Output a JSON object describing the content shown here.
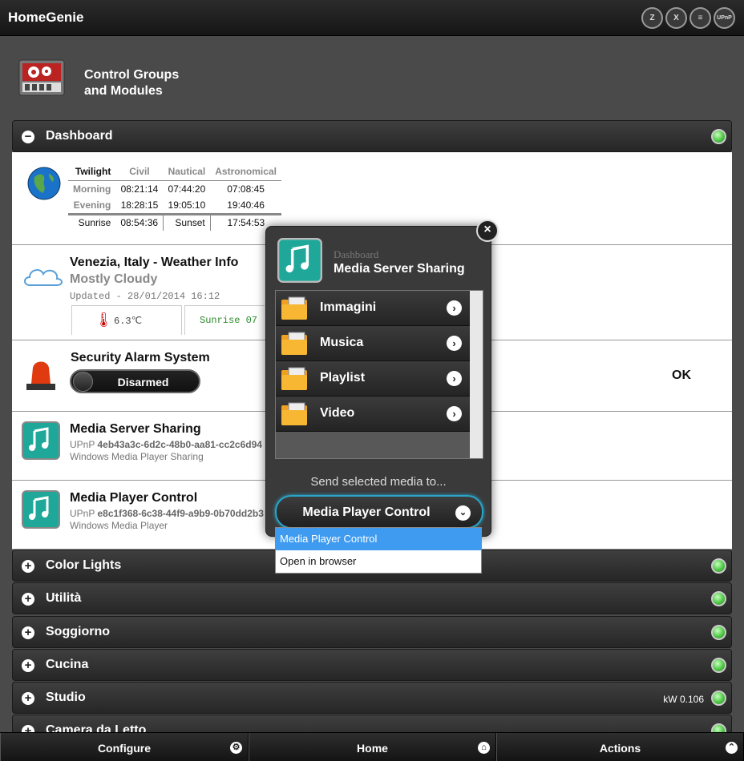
{
  "app": {
    "title": "HomeGenie",
    "protocols": [
      "Z",
      "X",
      "≡",
      "UPnP"
    ]
  },
  "header": {
    "title_line1": "Control Groups",
    "title_line2": "and Modules"
  },
  "dashboard": {
    "name": "Dashboard",
    "twilight": {
      "headers": [
        "Twilight",
        "Civil",
        "Nautical",
        "Astronomical"
      ],
      "rows": [
        {
          "label": "Morning",
          "civil": "08:21:14",
          "nautical": "07:44:20",
          "astro": "07:08:45"
        },
        {
          "label": "Evening",
          "civil": "18:28:15",
          "nautical": "19:05:10",
          "astro": "19:40:46"
        }
      ],
      "sunrise_label": "Sunrise",
      "sunrise": "08:54:36",
      "sunset_label": "Sunset",
      "sunset": "17:54:53"
    },
    "weather": {
      "title": "Venezia, Italy - Weather Info",
      "condition": "Mostly Cloudy",
      "updated": "Updated - 28/01/2014 16:12",
      "temp": "6.3℃",
      "sunrise": "Sunrise 07"
    },
    "security": {
      "title": "Security Alarm System",
      "state": "Disarmed",
      "status": "OK"
    },
    "media_server": {
      "title": "Media Server Sharing",
      "upnp_prefix": "UPnP",
      "upnp_id": "4eb43a3c-6d2c-48b0-aa81-cc2c6d94",
      "desc": "Windows Media Player Sharing"
    },
    "media_player": {
      "title": "Media Player Control",
      "upnp_prefix": "UPnP",
      "upnp_id": "e8c1f368-6c38-44f9-a9b9-0b70dd2b3",
      "desc": "Windows Media Player"
    }
  },
  "groups": [
    {
      "name": "Color Lights"
    },
    {
      "name": "Utilità"
    },
    {
      "name": "Soggiorno"
    },
    {
      "name": "Cucina"
    },
    {
      "name": "Studio",
      "kw": "kW 0.106"
    },
    {
      "name": "Camera da Letto"
    }
  ],
  "popup": {
    "subtitle": "Dashboard",
    "title": "Media Server Sharing",
    "items": [
      "Immagini",
      "Musica",
      "Playlist",
      "Video"
    ],
    "send_label": "Send selected media to...",
    "selected": "Media Player Control",
    "options": [
      "Media Player Control",
      "Open in browser"
    ]
  },
  "footer": {
    "configure": "Configure",
    "home": "Home",
    "actions": "Actions"
  },
  "colors": {
    "led": "#4ec845",
    "accent": "#2aa5c9",
    "selection": "#3e9bf0"
  }
}
